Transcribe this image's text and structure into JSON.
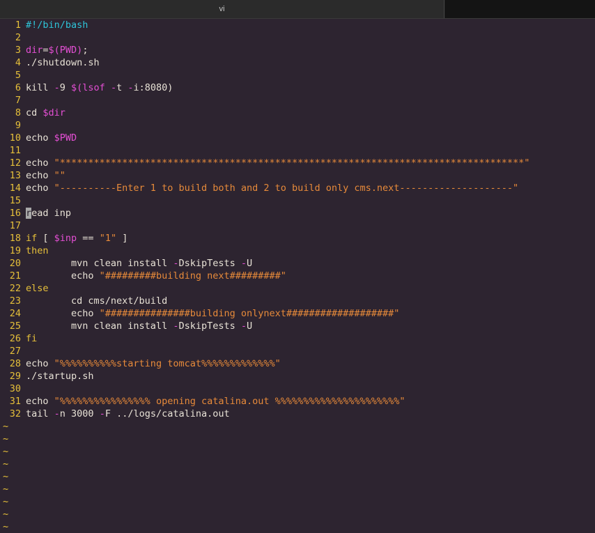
{
  "window": {
    "title": "vi"
  },
  "editor": {
    "lines": [
      {
        "n": "1",
        "t": "#!/bin/bash"
      },
      {
        "n": "2",
        "t": ""
      },
      {
        "n": "3",
        "t": "dir=$(PWD);"
      },
      {
        "n": "4",
        "t": "./shutdown.sh"
      },
      {
        "n": "5",
        "t": ""
      },
      {
        "n": "6",
        "t": "kill -9 $(lsof -t -i:8080)"
      },
      {
        "n": "7",
        "t": ""
      },
      {
        "n": "8",
        "t": "cd $dir"
      },
      {
        "n": "9",
        "t": ""
      },
      {
        "n": "10",
        "t": "echo $PWD"
      },
      {
        "n": "11",
        "t": ""
      },
      {
        "n": "12",
        "t": "echo \"**********************************************************************************\""
      },
      {
        "n": "13",
        "t": "echo \"\""
      },
      {
        "n": "14",
        "t": "echo \"----------Enter 1 to build both and 2 to build only cms.next--------------------\""
      },
      {
        "n": "15",
        "t": ""
      },
      {
        "n": "16",
        "t": "read inp"
      },
      {
        "n": "17",
        "t": ""
      },
      {
        "n": "18",
        "t": "if [ $inp == \"1\" ]"
      },
      {
        "n": "19",
        "t": "then"
      },
      {
        "n": "20",
        "t": "        mvn clean install -DskipTests -U"
      },
      {
        "n": "21",
        "t": "        echo \"#########building next#########\""
      },
      {
        "n": "22",
        "t": "else"
      },
      {
        "n": "23",
        "t": "        cd cms/next/build"
      },
      {
        "n": "24",
        "t": "        echo \"###############building onlynext###################\""
      },
      {
        "n": "25",
        "t": "        mvn clean install -DskipTests -U"
      },
      {
        "n": "26",
        "t": "fi"
      },
      {
        "n": "27",
        "t": ""
      },
      {
        "n": "28",
        "t": "echo \"%%%%%%%%%%starting tomcat%%%%%%%%%%%%%\""
      },
      {
        "n": "29",
        "t": "./startup.sh"
      },
      {
        "n": "30",
        "t": ""
      },
      {
        "n": "31",
        "t": "echo \"%%%%%%%%%%%%%%%% opening catalina.out %%%%%%%%%%%%%%%%%%%%%%\""
      },
      {
        "n": "32",
        "t": "tail -n 3000 -F ../logs/catalina.out"
      }
    ],
    "tilde": "~",
    "empty_rows": 9,
    "cursor_line": 16,
    "cursor_col": 0,
    "colors": {
      "background": "#2d2430",
      "line_number": "#e6c03a",
      "keyword": "#e6c03a",
      "variable": "#e44fd4",
      "string": "#e78a3a",
      "shebang": "#2ec5d9",
      "text": "#e8e2d6"
    }
  }
}
